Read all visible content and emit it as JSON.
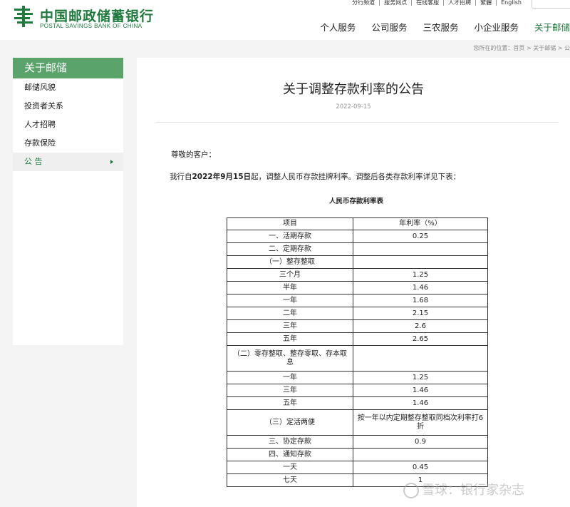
{
  "brand": {
    "name_cn": "中国邮政储蓄银行",
    "name_en": "POSTAL SAVINGS BANK OF CHINA",
    "color": "#1d7a3c"
  },
  "top_links": [
    "分行频道",
    "服务网点",
    "在线客服",
    "人才招聘",
    "繁體",
    "English"
  ],
  "main_nav": [
    {
      "label": "个人服务",
      "active": false
    },
    {
      "label": "公司服务",
      "active": false
    },
    {
      "label": "三农服务",
      "active": false
    },
    {
      "label": "小企业服务",
      "active": false
    },
    {
      "label": "关于邮储",
      "active": true
    }
  ],
  "breadcrumb": "您所在的位置：首页 > 关于邮储 > 公",
  "sidebar": {
    "title": "关于邮储",
    "items": [
      {
        "label": "邮储风貌",
        "active": false
      },
      {
        "label": "投资者关系",
        "active": false
      },
      {
        "label": "人才招聘",
        "active": false
      },
      {
        "label": "存款保险",
        "active": false
      },
      {
        "label": "公 告",
        "active": true
      }
    ]
  },
  "article": {
    "title": "关于调整存款利率的公告",
    "date": "2022-09-15",
    "greeting": "尊敬的客户：",
    "intro_pre": "我行自",
    "intro_bold": "2022年9月15日",
    "intro_post": "起，调整人民币存款挂牌利率。调整后各类存款利率详见下表：",
    "table_title": "人民币存款利率表",
    "table": {
      "headers": [
        "项目",
        "年利率（%）"
      ],
      "rows": [
        [
          "一、活期存款",
          "0.25"
        ],
        [
          "二、定期存款",
          ""
        ],
        [
          "（一）整存整取",
          ""
        ],
        [
          "三个月",
          "1.25"
        ],
        [
          "半年",
          "1.46"
        ],
        [
          "一年",
          "1.68"
        ],
        [
          "二年",
          "2.15"
        ],
        [
          "三年",
          "2.6"
        ],
        [
          "五年",
          "2.65"
        ],
        [
          "（二）零存整取、整存零取、存本取息",
          ""
        ],
        [
          "一年",
          "1.25"
        ],
        [
          "三年",
          "1.46"
        ],
        [
          "五年",
          "1.46"
        ],
        [
          "（三）定活两便",
          "按一年以内定期整存整取同档次利率打6折"
        ],
        [
          "三、协定存款",
          "0.9"
        ],
        [
          "四、通知存款",
          ""
        ],
        [
          "一天",
          "0.45"
        ],
        [
          "七天",
          "1"
        ]
      ]
    }
  },
  "watermark": "雪球：银行家杂志"
}
